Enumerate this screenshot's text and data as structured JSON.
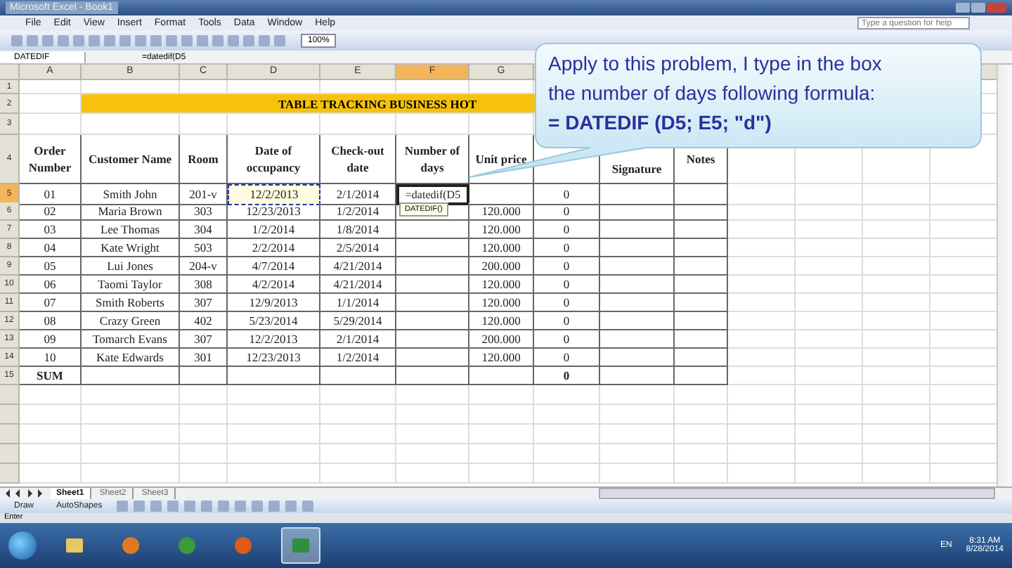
{
  "window": {
    "title": "Microsoft Excel - Book1"
  },
  "menu": [
    "File",
    "Edit",
    "View",
    "Insert",
    "Format",
    "Tools",
    "Data",
    "Window",
    "Help"
  ],
  "help_search": {
    "placeholder": "Type a question for help"
  },
  "toolbar": {
    "zoom": "100%"
  },
  "formula_bar": {
    "name_box": "DATEDIF",
    "formula": "=datedif(D5"
  },
  "columns": [
    {
      "letter": "A",
      "selected": false
    },
    {
      "letter": "B",
      "selected": false
    },
    {
      "letter": "C",
      "selected": false
    },
    {
      "letter": "D",
      "selected": false
    },
    {
      "letter": "E",
      "selected": false
    },
    {
      "letter": "F",
      "selected": true
    },
    {
      "letter": "G",
      "selected": false
    }
  ],
  "row_headers": [
    {
      "label": "1",
      "selected": false
    },
    {
      "label": "2",
      "selected": false
    },
    {
      "label": "3",
      "selected": false
    },
    {
      "label": "4",
      "selected": false
    },
    {
      "label": "5",
      "selected": true
    },
    {
      "label": "6",
      "selected": false
    },
    {
      "label": "7",
      "selected": false
    },
    {
      "label": "8",
      "selected": false
    },
    {
      "label": "9",
      "selected": false
    },
    {
      "label": "10",
      "selected": false
    },
    {
      "label": "11",
      "selected": false
    },
    {
      "label": "12",
      "selected": false
    },
    {
      "label": "13",
      "selected": false
    },
    {
      "label": "14",
      "selected": false
    },
    {
      "label": "15",
      "selected": false
    }
  ],
  "title_band": "TABLE TRACKING BUSINESS HOT",
  "table": {
    "columns": [
      {
        "heading": "Order Number"
      },
      {
        "heading": "Customer Name"
      },
      {
        "heading": "Room"
      },
      {
        "heading": "Date of occupancy"
      },
      {
        "heading": "Check-out date"
      },
      {
        "heading": "Number of days"
      },
      {
        "heading": "Unit price"
      },
      {},
      {
        "heading": "Signature"
      },
      {
        "heading": "Notes"
      }
    ],
    "rows": [
      {
        "order": "01",
        "name": "Smith John",
        "room": "201-v",
        "check_in": "12/2/2013",
        "check_out": "2/1/2014",
        "days": "=datedif(D5",
        "amount": "0",
        "referenced": true,
        "editing": true,
        "tooltip": "DATEDIF()"
      },
      {
        "order": "02",
        "name": "Maria Brown",
        "room": "303",
        "check_in": "12/23/2013",
        "check_out": "1/2/2014",
        "unit_price": "120.000",
        "amount": "0",
        "referenced": false,
        "editing": false
      },
      {
        "order": "03",
        "name": "Lee Thomas",
        "room": "304",
        "check_in": "1/2/2014",
        "check_out": "1/8/2014",
        "unit_price": "120.000",
        "amount": "0",
        "referenced": false,
        "editing": false
      },
      {
        "order": "04",
        "name": "Kate Wright",
        "room": "503",
        "check_in": "2/2/2014",
        "check_out": "2/5/2014",
        "unit_price": "120.000",
        "amount": "0",
        "referenced": false,
        "editing": false
      },
      {
        "order": "05",
        "name": "Lui Jones",
        "room": "204-v",
        "check_in": "4/7/2014",
        "check_out": "4/21/2014",
        "unit_price": "200.000",
        "amount": "0",
        "referenced": false,
        "editing": false
      },
      {
        "order": "06",
        "name": "Taomi Taylor",
        "room": "308",
        "check_in": "4/2/2014",
        "check_out": "4/21/2014",
        "unit_price": "120.000",
        "amount": "0",
        "referenced": false,
        "editing": false
      },
      {
        "order": "07",
        "name": "Smith Roberts",
        "room": "307",
        "check_in": "12/9/2013",
        "check_out": "1/1/2014",
        "unit_price": "120.000",
        "amount": "0",
        "referenced": false,
        "editing": false
      },
      {
        "order": "08",
        "name": "Crazy Green",
        "room": "402",
        "check_in": "5/23/2014",
        "check_out": "5/29/2014",
        "unit_price": "120.000",
        "amount": "0",
        "referenced": false,
        "editing": false
      },
      {
        "order": "09",
        "name": "Tomarch Evans",
        "room": "307",
        "check_in": "12/2/2013",
        "check_out": "2/1/2014",
        "unit_price": "200.000",
        "amount": "0",
        "referenced": false,
        "editing": false
      },
      {
        "order": "10",
        "name": "Kate Edwards",
        "room": "301",
        "check_in": "12/23/2013",
        "check_out": "1/2/2014",
        "unit_price": "120.000",
        "amount": "0",
        "referenced": false,
        "editing": false
      }
    ],
    "total": {
      "label": "SUM",
      "amount": "0"
    }
  },
  "callout": {
    "lines": [
      "Apply to this problem, I type in the box",
      "the number of days following formula:"
    ],
    "formula": "= DATEDIF (D5; E5; \"d\")"
  },
  "sheet_tabs": [
    {
      "label": "Sheet1",
      "selected": true
    },
    {
      "label": "Sheet2",
      "selected": false
    },
    {
      "label": "Sheet3",
      "selected": false
    }
  ],
  "drawing_toolbar": [
    "Draw",
    "AutoShapes"
  ],
  "status_bar": "Enter",
  "taskbar": {
    "apps": [
      {
        "kind": "folder",
        "active": false
      },
      {
        "kind": "media",
        "active": false
      },
      {
        "kind": "browser",
        "active": false
      },
      {
        "kind": "firefox",
        "active": false
      },
      {
        "kind": "excel",
        "active": true
      }
    ],
    "language": "EN",
    "time": "8:31 AM",
    "date": "8/28/2014"
  }
}
